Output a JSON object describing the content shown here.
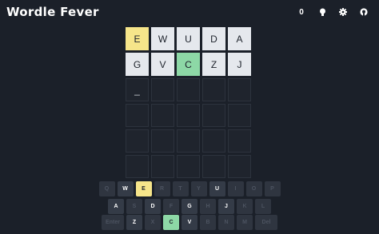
{
  "header": {
    "title": "Wordle Fever",
    "streak_count": "0",
    "icons": [
      "hint-lightbulb-icon",
      "settings-gear-icon",
      "github-icon"
    ]
  },
  "colors": {
    "background": "#1b2029",
    "tile_filled": "#e5e8ed",
    "tile_present": "#f6e58a",
    "tile_correct": "#8dd8a6",
    "tile_empty": "#1f242d",
    "key_default": "#2f3540"
  },
  "board": {
    "rows": [
      [
        {
          "letter": "E",
          "state": "present"
        },
        {
          "letter": "W",
          "state": "absent"
        },
        {
          "letter": "U",
          "state": "absent"
        },
        {
          "letter": "D",
          "state": "absent"
        },
        {
          "letter": "A",
          "state": "absent"
        }
      ],
      [
        {
          "letter": "G",
          "state": "absent"
        },
        {
          "letter": "V",
          "state": "absent"
        },
        {
          "letter": "C",
          "state": "correct"
        },
        {
          "letter": "Z",
          "state": "absent"
        },
        {
          "letter": "J",
          "state": "absent"
        }
      ],
      [
        {
          "letter": "_",
          "state": "cursor"
        },
        {
          "letter": "",
          "state": "empty"
        },
        {
          "letter": "",
          "state": "empty"
        },
        {
          "letter": "",
          "state": "empty"
        },
        {
          "letter": "",
          "state": "empty"
        }
      ],
      [
        {
          "letter": "",
          "state": "empty"
        },
        {
          "letter": "",
          "state": "empty"
        },
        {
          "letter": "",
          "state": "empty"
        },
        {
          "letter": "",
          "state": "empty"
        },
        {
          "letter": "",
          "state": "empty"
        }
      ],
      [
        {
          "letter": "",
          "state": "empty"
        },
        {
          "letter": "",
          "state": "empty"
        },
        {
          "letter": "",
          "state": "empty"
        },
        {
          "letter": "",
          "state": "empty"
        },
        {
          "letter": "",
          "state": "empty"
        }
      ],
      [
        {
          "letter": "",
          "state": "empty"
        },
        {
          "letter": "",
          "state": "empty"
        },
        {
          "letter": "",
          "state": "empty"
        },
        {
          "letter": "",
          "state": "empty"
        },
        {
          "letter": "",
          "state": "empty"
        }
      ]
    ]
  },
  "keyboard": {
    "rows": [
      [
        {
          "label": "Q",
          "state": "unused"
        },
        {
          "label": "W",
          "state": "used"
        },
        {
          "label": "E",
          "state": "present"
        },
        {
          "label": "R",
          "state": "unused"
        },
        {
          "label": "T",
          "state": "unused"
        },
        {
          "label": "Y",
          "state": "unused"
        },
        {
          "label": "U",
          "state": "used"
        },
        {
          "label": "I",
          "state": "unused"
        },
        {
          "label": "O",
          "state": "unused"
        },
        {
          "label": "P",
          "state": "unused"
        }
      ],
      [
        {
          "label": "A",
          "state": "used"
        },
        {
          "label": "S",
          "state": "unused"
        },
        {
          "label": "D",
          "state": "used"
        },
        {
          "label": "F",
          "state": "unused"
        },
        {
          "label": "G",
          "state": "used"
        },
        {
          "label": "H",
          "state": "unused"
        },
        {
          "label": "J",
          "state": "used"
        },
        {
          "label": "K",
          "state": "unused"
        },
        {
          "label": "L",
          "state": "unused"
        }
      ],
      [
        {
          "label": "Enter",
          "state": "unused",
          "wide": true
        },
        {
          "label": "Z",
          "state": "used"
        },
        {
          "label": "X",
          "state": "unused"
        },
        {
          "label": "C",
          "state": "correct"
        },
        {
          "label": "V",
          "state": "used"
        },
        {
          "label": "B",
          "state": "unused"
        },
        {
          "label": "N",
          "state": "unused"
        },
        {
          "label": "M",
          "state": "unused"
        },
        {
          "label": "Del",
          "state": "unused",
          "wide": true
        }
      ]
    ]
  }
}
